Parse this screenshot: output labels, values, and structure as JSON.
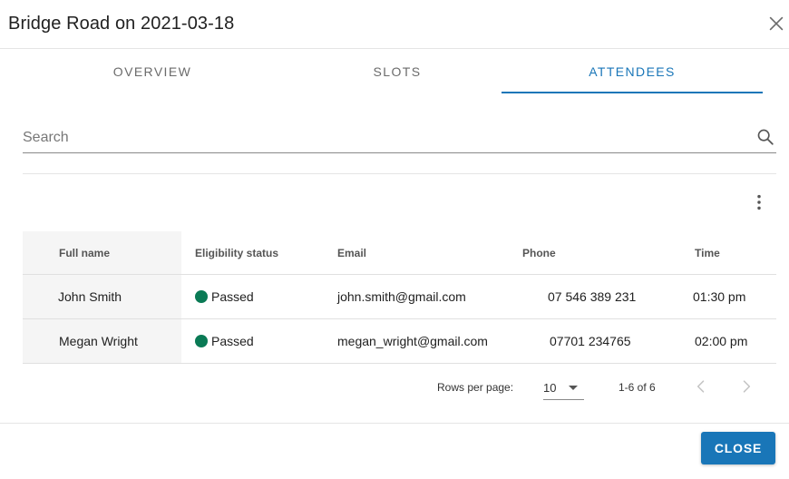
{
  "dialog": {
    "title": "Bridge Road on 2021-03-18",
    "close_icon": "close-icon"
  },
  "tabs": [
    {
      "label": "OVERVIEW",
      "active": false
    },
    {
      "label": "SLOTS",
      "active": false
    },
    {
      "label": "ATTENDEES",
      "active": true
    }
  ],
  "search": {
    "placeholder": "Search",
    "value": "",
    "icon": "search-icon"
  },
  "toolbar": {
    "more_icon": "more-vertical-icon"
  },
  "table": {
    "columns": [
      "Full name",
      "Eligibility status",
      "Email",
      "Phone",
      "Time"
    ],
    "rows": [
      {
        "full_name": "John Smith",
        "status": "Passed",
        "status_color": "#0a7a55",
        "email": "john.smith@gmail.com",
        "phone": "07 546 389 231",
        "time": "01:30 pm"
      },
      {
        "full_name": "Megan Wright",
        "status": "Passed",
        "status_color": "#0a7a55",
        "email": "megan_wright@gmail.com",
        "phone": "07701 234765",
        "time": "02:00 pm"
      }
    ]
  },
  "pagination": {
    "rows_per_page_label": "Rows per page:",
    "rows_per_page": "10",
    "range": "1-6 of 6",
    "prev_icon": "chevron-left-icon",
    "next_icon": "chevron-right-icon"
  },
  "footer": {
    "close_label": "CLOSE"
  },
  "colors": {
    "accent": "#1976b8",
    "status_passed": "#0a7a55"
  }
}
